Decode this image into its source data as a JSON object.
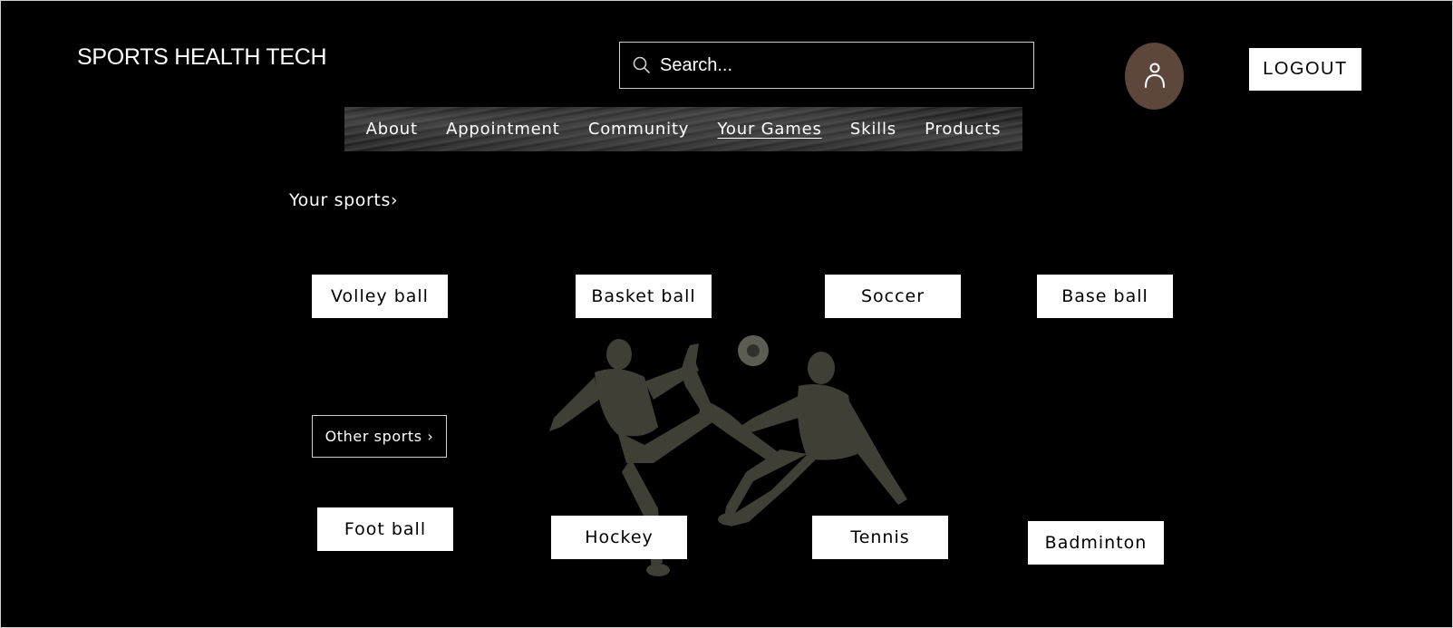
{
  "header": {
    "brand": "SPORTS HEALTH TECH",
    "search_placeholder": "Search...",
    "logout_label": "LOGOUT"
  },
  "nav": {
    "items": [
      {
        "label": "About"
      },
      {
        "label": "Appointment"
      },
      {
        "label": "Community"
      },
      {
        "label": "Your Games",
        "active": true
      },
      {
        "label": "Skills"
      },
      {
        "label": "Products"
      }
    ]
  },
  "main": {
    "section_title": "Your sports›",
    "sports": [
      {
        "label": "Volley ball"
      },
      {
        "label": "Basket ball"
      },
      {
        "label": "Soccer"
      },
      {
        "label": "Base ball"
      },
      {
        "label": "Foot ball"
      },
      {
        "label": "Hockey"
      },
      {
        "label": "Tennis"
      },
      {
        "label": "Badminton"
      }
    ],
    "other_sports_label": "Other sports ›"
  },
  "colors": {
    "background": "#000000",
    "avatar": "#5d463b",
    "button_bg": "#ffffff",
    "text": "#ffffff"
  },
  "icons": {
    "search": "search-icon",
    "avatar": "user-icon",
    "hero": "soccer-players-image"
  }
}
